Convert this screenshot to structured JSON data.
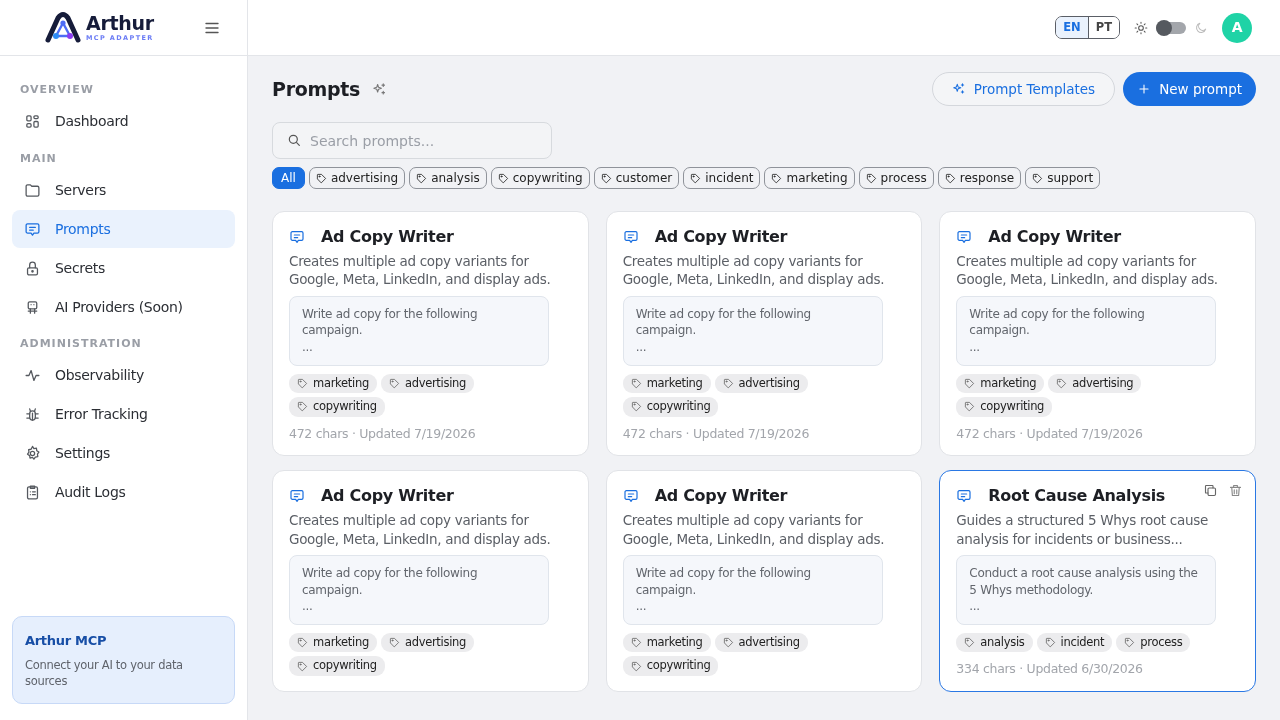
{
  "brand": {
    "name": "Arthur",
    "tagline": "MCP ADAPTER"
  },
  "header": {
    "languages": [
      {
        "label": "EN",
        "selected": true
      },
      {
        "label": "PT",
        "selected": false
      }
    ],
    "dark_mode": false,
    "avatar": "A"
  },
  "sidebar": {
    "sections": [
      {
        "title": "OVERVIEW",
        "items": [
          {
            "label": "Dashboard",
            "selected": false
          }
        ]
      },
      {
        "title": "MAIN",
        "items": [
          {
            "label": "Servers",
            "selected": false
          },
          {
            "label": "Prompts",
            "selected": true
          },
          {
            "label": "Secrets",
            "selected": false
          },
          {
            "label": "AI Providers (Soon)",
            "selected": false
          }
        ]
      },
      {
        "title": "ADMINISTRATION",
        "items": [
          {
            "label": "Observability",
            "selected": false
          },
          {
            "label": "Error Tracking",
            "selected": false
          },
          {
            "label": "Settings",
            "selected": false
          },
          {
            "label": "Audit Logs",
            "selected": false
          }
        ]
      }
    ],
    "promo": {
      "title": "Arthur MCP",
      "text": "Connect your AI to your data sources"
    }
  },
  "page": {
    "title": "Prompts",
    "buttons": [
      {
        "label": "Prompt Templates",
        "kind": "outline"
      },
      {
        "label": "New prompt",
        "kind": "primary"
      }
    ],
    "search": {
      "placeholder": "Search prompts..."
    },
    "filters": [
      {
        "label": "All",
        "selected": true
      },
      {
        "label": "advertising",
        "selected": false
      },
      {
        "label": "analysis",
        "selected": false
      },
      {
        "label": "copywriting",
        "selected": false
      },
      {
        "label": "customer",
        "selected": false
      },
      {
        "label": "incident",
        "selected": false
      },
      {
        "label": "marketing",
        "selected": false
      },
      {
        "label": "process",
        "selected": false
      },
      {
        "label": "response",
        "selected": false
      },
      {
        "label": "support",
        "selected": false
      }
    ]
  },
  "prompts": [
    {
      "title": "Ad Copy Writer",
      "description": "Creates multiple ad copy variants for Google, Meta, LinkedIn, and display ads.",
      "preview": "Write ad copy for the following campaign.\n...",
      "tags": [
        "marketing",
        "advertising",
        "copywriting"
      ],
      "meta": "472 chars · Updated 7/19/2026",
      "hovered": false
    },
    {
      "title": "Ad Copy Writer",
      "description": "Creates multiple ad copy variants for Google, Meta, LinkedIn, and display ads.",
      "preview": "Write ad copy for the following campaign.\n...",
      "tags": [
        "marketing",
        "advertising",
        "copywriting"
      ],
      "meta": "472 chars · Updated 7/19/2026",
      "hovered": false
    },
    {
      "title": "Ad Copy Writer",
      "description": "Creates multiple ad copy variants for Google, Meta, LinkedIn, and display ads.",
      "preview": "Write ad copy for the following campaign.\n...",
      "tags": [
        "marketing",
        "advertising",
        "copywriting"
      ],
      "meta": "472 chars · Updated 7/19/2026",
      "hovered": false
    },
    {
      "title": "Ad Copy Writer",
      "description": "Creates multiple ad copy variants for Google, Meta, LinkedIn, and display ads.",
      "preview": "Write ad copy for the following campaign.\n...",
      "tags": [
        "marketing",
        "advertising",
        "copywriting"
      ],
      "hovered": false
    },
    {
      "title": "Ad Copy Writer",
      "description": "Creates multiple ad copy variants for Google, Meta, LinkedIn, and display ads.",
      "preview": "Write ad copy for the following campaign.\n...",
      "tags": [
        "marketing",
        "advertising",
        "copywriting"
      ],
      "hovered": false
    },
    {
      "title": "Root Cause Analysis",
      "description": "Guides a structured 5 Whys root cause analysis for incidents or business...",
      "preview": "Conduct a root cause analysis using the 5 Whys methodology.\n...",
      "tags": [
        "analysis",
        "incident",
        "process"
      ],
      "meta": "334 chars · Updated 6/30/2026",
      "hovered": true
    }
  ]
}
